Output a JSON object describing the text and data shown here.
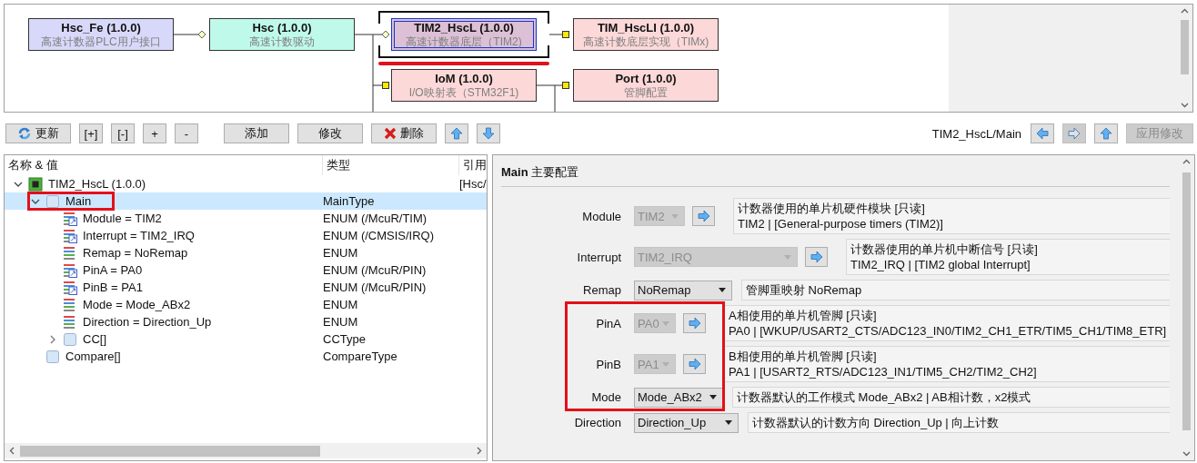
{
  "diagram": {
    "nodes": [
      {
        "title": "Hsc_Fe (1.0.0)",
        "subtitle": "高速计数器PLC用户接口",
        "color": "#d8d8fa",
        "selected": false,
        "highlighted": false
      },
      {
        "title": "Hsc (1.0.0)",
        "subtitle": "高速计数驱动",
        "color": "#bff9ea",
        "selected": false,
        "highlighted": false
      },
      {
        "title": "TIM2_HscL (1.0.0)",
        "subtitle": "高速计数器底层（TIM2)",
        "color": "#dcc0d6",
        "selected": true,
        "highlighted": true
      },
      {
        "title": "TIM_HscLI (1.0.0)",
        "subtitle": "高速计数底层实现（TIMx)",
        "color": "#fdd8d8",
        "selected": false,
        "highlighted": false
      },
      {
        "title": "IoM (1.0.0)",
        "subtitle": "I/O映射表（STM32F1)",
        "color": "#fdd8d8",
        "selected": false,
        "highlighted": false
      },
      {
        "title": "Port (1.0.0)",
        "subtitle": "管脚配置",
        "color": "#fdd8d8",
        "selected": false,
        "highlighted": false
      }
    ]
  },
  "toolbar": {
    "groups": [
      [
        {
          "kind": "refresh",
          "label": "更新"
        },
        {
          "kind": "small",
          "label": "[+]"
        },
        {
          "kind": "small",
          "label": "[-]"
        },
        {
          "kind": "small",
          "label": "+"
        },
        {
          "kind": "small",
          "label": "-"
        }
      ],
      [
        {
          "kind": "wide",
          "label": "添加"
        },
        {
          "kind": "wide",
          "label": "修改"
        },
        {
          "kind": "delete",
          "label": "删除"
        },
        {
          "kind": "up"
        },
        {
          "kind": "down"
        }
      ]
    ],
    "path": "TIM2_HscL/Main",
    "nav": [
      {
        "kind": "back",
        "disabled": false
      },
      {
        "kind": "forward",
        "disabled": true
      },
      {
        "kind": "up",
        "disabled": false
      },
      {
        "kind": "wide",
        "label": "应用修改",
        "disabled": true
      }
    ]
  },
  "tree": {
    "columns": [
      "名称 & 值",
      "类型",
      "引用"
    ],
    "items": [
      {
        "name": "TIM2_HscL (1.0.0)",
        "kind": "chip",
        "ref": "[Hsc/",
        "expanded": true,
        "selected": false,
        "highlighted": false,
        "children": [
          {
            "name": "Main",
            "kind": "struct",
            "type": "MainType",
            "expanded": true,
            "selected": true,
            "highlighted": true,
            "children": [
              {
                "name": "Module = TIM2",
                "kind": "enum_ref",
                "type": "ENUM (/McuR/TIM)",
                "selected": false,
                "highlighted": false
              },
              {
                "name": "Interrupt = TIM2_IRQ",
                "kind": "enum_ref",
                "type": "ENUM (/CMSIS/IRQ)",
                "selected": false,
                "highlighted": false
              },
              {
                "name": "Remap = NoRemap",
                "kind": "enum",
                "type": "ENUM",
                "selected": false,
                "highlighted": false
              },
              {
                "name": "PinA = PA0",
                "kind": "enum_ref",
                "type": "ENUM (/McuR/PIN)",
                "selected": false,
                "highlighted": false
              },
              {
                "name": "PinB = PA1",
                "kind": "enum_ref",
                "type": "ENUM (/McuR/PIN)",
                "selected": false,
                "highlighted": false
              },
              {
                "name": "Mode = Mode_ABx2",
                "kind": "enum",
                "type": "ENUM",
                "selected": false,
                "highlighted": false
              },
              {
                "name": "Direction = Direction_Up",
                "kind": "enum",
                "type": "ENUM",
                "selected": false,
                "highlighted": false
              },
              {
                "name": "CC[]",
                "kind": "struct",
                "type": "CCType",
                "expanded": false,
                "selected": false,
                "highlighted": false
              }
            ]
          },
          {
            "name": "Compare[]",
            "kind": "struct",
            "type": "CompareType",
            "selected": false,
            "highlighted": false
          }
        ]
      }
    ]
  },
  "panel": {
    "title": "**Main** 主要配置",
    "sections": [
      {
        "highlighted": false,
        "rows": [
          {
            "label": "Module",
            "value": "TIM2",
            "disabled": true,
            "link": true,
            "description": [
              "计数器使用的单片机硬件模块 [只读]",
              "TIM2 | [General-purpose timers (TIM2)]"
            ]
          },
          {
            "label": "Interrupt",
            "value": "TIM2_IRQ",
            "disabled": true,
            "link": true,
            "description": [
              "计数器使用的单片机中断信号 [只读]",
              "TIM2_IRQ | [TIM2 global Interrupt]"
            ]
          },
          {
            "label": "Remap",
            "value": "NoRemap",
            "disabled": false,
            "link": false,
            "description": [
              "管脚重映射 NoRemap"
            ]
          }
        ]
      },
      {
        "highlighted": true,
        "rows": [
          {
            "label": "PinA",
            "value": "PA0",
            "disabled": true,
            "link": true,
            "description": [
              "A相使用的单片机管脚 [只读]",
              "PA0 | [WKUP/USART2_CTS/ADC123_IN0/TIM2_CH1_ETR/TIM5_CH1/TIM8_ETR]"
            ]
          },
          {
            "label": "PinB",
            "value": "PA1",
            "disabled": true,
            "link": true,
            "description": [
              "B相使用的单片机管脚 [只读]",
              "PA1 | [USART2_RTS/ADC123_IN1/TIM5_CH2/TIM2_CH2]"
            ]
          },
          {
            "label": "Mode",
            "value": "Mode_ABx2",
            "disabled": false,
            "link": false,
            "description": [
              "计数器默认的工作模式 Mode_ABx2 | AB相计数，x2模式"
            ]
          }
        ]
      },
      {
        "highlighted": false,
        "rows": [
          {
            "label": "Direction",
            "value": "Direction_Up",
            "disabled": false,
            "link": false,
            "description": [
              "计数器默认的计数方向 Direction_Up | 向上计数"
            ]
          }
        ]
      }
    ]
  }
}
